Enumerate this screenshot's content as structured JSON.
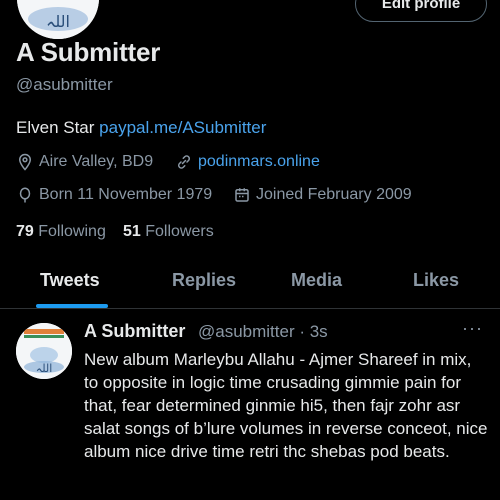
{
  "header": {
    "edit_profile_label": "Edit profile"
  },
  "profile": {
    "name": "A Submitter",
    "handle": "@asubmitter",
    "bio_text": "Elven Star ",
    "bio_link": "paypal.me/ASubmitter",
    "location": "Aire Valley, BD9",
    "website": "podinmars.online",
    "born": "Born 11 November 1979",
    "joined": "Joined February 2009",
    "following_count": "79",
    "following_label": "Following",
    "followers_count": "51",
    "followers_label": "Followers",
    "avatar_caption": "اللہ"
  },
  "tabs": [
    {
      "label": "Tweets",
      "active": true
    },
    {
      "label": "Replies",
      "active": false
    },
    {
      "label": "Media",
      "active": false
    },
    {
      "label": "Likes",
      "active": false
    }
  ],
  "tweet": {
    "author": "A Submitter",
    "handle_time": "@asubmitter · 3s",
    "more": "···",
    "text": "New album Marleybu Allahu - Ajmer Shareef in mix, to opposite in logic time crusading gimmie pain for that, fear determined ginmie hi5, then fajr zohr asr salat songs of b’lure volumes in reverse conceot, nice album nice drive time retri thc shebas pod beats."
  },
  "colors": {
    "background": "#000000",
    "text": "#e7e9ea",
    "secondary": "#8b98a5",
    "link": "#4aa3ec",
    "accent": "#1d9bf0"
  }
}
